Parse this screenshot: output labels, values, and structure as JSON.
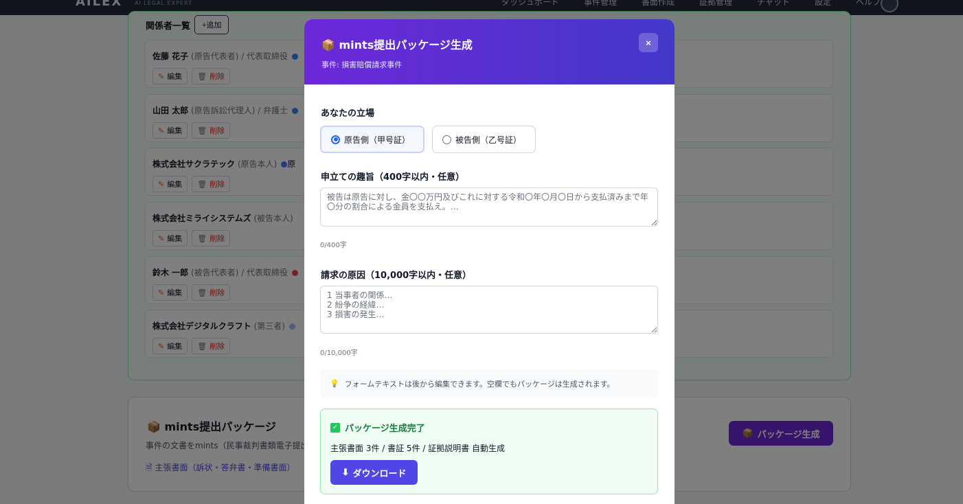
{
  "nav": {
    "logo": "AILEX",
    "logo_sub": "AI LEGAL EXPERT",
    "items": [
      "ダッシュボード",
      "事件管理",
      "書面作成",
      "証拠管理",
      "チャット",
      "設定",
      "ヘルプ"
    ]
  },
  "parties": {
    "title": "関係者一覧",
    "add_label": "+追加",
    "edit_label": "編集",
    "delete_label": "削除",
    "items": [
      {
        "name": "佐藤 花子",
        "role": "(原告代表者) / 代表取締役",
        "dot_color": "#3b82f6"
      },
      {
        "name": "山田 太郎",
        "role": "(原告訴訟代理人) / 弁護士",
        "dot_color": "#3b82f6"
      },
      {
        "name": "株式会社サクラテック",
        "role": "(原告本人)",
        "dot_color": "#3b82f6",
        "badge": "原"
      },
      {
        "name": "株式会社ミライシステムズ",
        "role": "(被告本人)",
        "dot_color": ""
      },
      {
        "name": "鈴木 一郎",
        "role": "(被告代表者) / 代表取締役",
        "dot_color": "#ef4444"
      },
      {
        "name": "株式会社デジタルクラフト",
        "role": "(第三者)",
        "dot_color": "#a5b4fc"
      }
    ]
  },
  "package_section": {
    "title": "mints提出パッケージ",
    "desc": "事件の文書をmints（民事裁判書類電子提出",
    "link": "主張書面（訴状・答弁書・準備書面）",
    "gen_button": "パッケージ生成"
  },
  "modal": {
    "title": "mints提出パッケージ生成",
    "subtitle": "事件: 損害賠償請求事件",
    "close_label": "×",
    "stance_label": "あなたの立場",
    "stance_options": [
      {
        "label": "原告側（甲号証）",
        "selected": true
      },
      {
        "label": "被告側（乙号証）",
        "selected": false
      }
    ],
    "purpose_label": "申立ての趣旨（400字以内・任意）",
    "purpose_placeholder": "被告は原告に対し、金〇〇万円及びこれに対する令和〇年〇月〇日から支払済みまで年〇分の割合による金員を支払え。…",
    "purpose_counter": "0/400字",
    "cause_label": "請求の原因（10,000字以内・任意）",
    "cause_placeholder": "1 当事者の関係…\n2 紛争の経緯…\n3 損害の発生…",
    "cause_counter": "0/10,000字",
    "tip": "フォームテキストは後から編集できます。空欄でもパッケージは生成されます。",
    "success_title": "パッケージ生成完了",
    "success_desc": "主張書面 3件 / 書証 5件 / 証拠説明書 自動生成",
    "download_label": "ダウンロード"
  }
}
